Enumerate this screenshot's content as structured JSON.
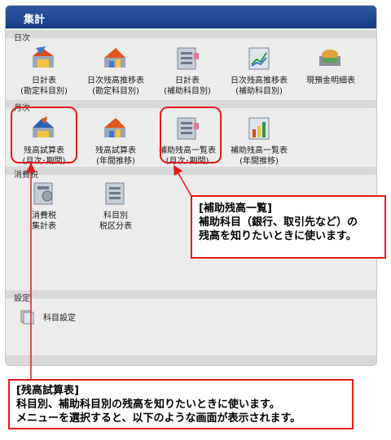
{
  "panel": {
    "title": "集計"
  },
  "sections": {
    "daily": "日次",
    "monthly": "月次",
    "tax": "消費税",
    "settings": "設定"
  },
  "daily_tiles": [
    {
      "line1": "日計表",
      "line2": "(勘定科目別)",
      "icon": "calendar-chart-icon"
    },
    {
      "line1": "日次残高推移表",
      "line2": "(勘定科目別)",
      "icon": "trend-chart-icon"
    },
    {
      "line1": "日計表",
      "line2": "(補助科目別)",
      "icon": "ledger-icon"
    },
    {
      "line1": "日次残高推移表",
      "line2": "(補助科目別)",
      "icon": "line-chart-icon"
    },
    {
      "line1": "現預金明細表",
      "line2": "",
      "icon": "cash-icon"
    }
  ],
  "monthly_tiles": [
    {
      "line1": "残高試算表",
      "line2": "(月次･期間)",
      "icon": "trial-balance-icon"
    },
    {
      "line1": "残高試算表",
      "line2": "(年間推移)",
      "icon": "trend-chart-icon"
    },
    {
      "line1": "補助残高一覧表",
      "line2": "(月次･期間)",
      "icon": "ledger-icon"
    },
    {
      "line1": "補助残高一覧表",
      "line2": "(年間推移)",
      "icon": "bar-chart-icon"
    }
  ],
  "tax_tiles": [
    {
      "line1": "消費税",
      "line2": "集計表",
      "icon": "tax-icon"
    },
    {
      "line1": "科目別",
      "line2": "税区分表",
      "icon": "ledger-icon"
    }
  ],
  "settings_item": {
    "label": "科目設定",
    "icon": "settings-book-icon"
  },
  "callouts": {
    "subsidiary": {
      "title": "[補助残高一覧]",
      "line1": "補助科目（銀行、取引先など）の",
      "line2": "残高を知りたいときに使います。"
    },
    "trial": {
      "title": "[残高試算表]",
      "line1": "科目別、補助科目別の残高を知りたいときに使います。",
      "line2": "メニューを選択すると、以下のような画面が表示されます。"
    }
  },
  "colors": {
    "header": "#1f4a96",
    "annotation": "#e21b1b",
    "panel": "#ececec"
  }
}
